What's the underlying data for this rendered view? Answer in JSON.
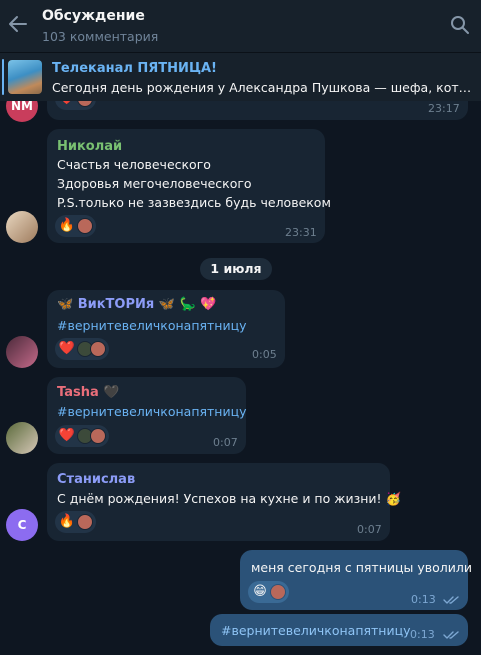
{
  "header": {
    "title": "Обсуждение",
    "subtitle": "103 комментария"
  },
  "pinned": {
    "title": "Телеканал ПЯТНИЦА!",
    "text": "Сегодня день рождения у Александра Пушкова — шефа, который..."
  },
  "messages": [
    {
      "id": "m0",
      "avatar_initials": "NM",
      "time": "23:17",
      "reactions": [
        "❤️",
        "avatar"
      ]
    },
    {
      "id": "m1",
      "sender": "Николай",
      "lines": [
        "Счастья человеческого",
        "Здоровья мегочеловеческого",
        "P.S.только не зазвездись будь человеком"
      ],
      "time": "23:31",
      "reactions": [
        "🔥",
        "avatar"
      ]
    },
    {
      "id": "m2",
      "sender": "🦋 ВикТОРИя 🦋 🦕 💖",
      "text": "#вернитевеличконапятницу",
      "time": "0:05",
      "reactions": [
        "❤️",
        "avatar",
        "avatar"
      ]
    },
    {
      "id": "m3",
      "sender": "Tasha 🖤",
      "text": "#вернитевеличконапятницу",
      "time": "0:07",
      "reactions": [
        "❤️",
        "avatar",
        "avatar"
      ]
    },
    {
      "id": "m4",
      "sender": "Станислав",
      "avatar_initials": "C",
      "text": "С днём рождения! Успехов на кухне и по жизни! 🥳",
      "time": "0:07",
      "reactions": [
        "🔥",
        "avatar"
      ]
    },
    {
      "id": "m5",
      "outgoing": true,
      "text": "меня сегодня с пятницы уволили",
      "time": "0:13",
      "reactions": [
        "😁",
        "avatar"
      ]
    },
    {
      "id": "m6",
      "outgoing": true,
      "text": "#вернитевеличконапятницу",
      "time": "0:13"
    }
  ],
  "date_separator": "1 июля",
  "colors": {
    "background": "#0e1621",
    "bubble_in": "#182533",
    "bubble_out": "#2b5278",
    "accent": "#6ab3f3",
    "sender_nikolay": "#79c071",
    "sender_viktoria": "#8c9cf7",
    "sender_tasha": "#e96e7a",
    "sender_stanislav": "#8c9cf7"
  },
  "icons": [
    "back-arrow-icon",
    "search-icon",
    "double-check-icon"
  ]
}
